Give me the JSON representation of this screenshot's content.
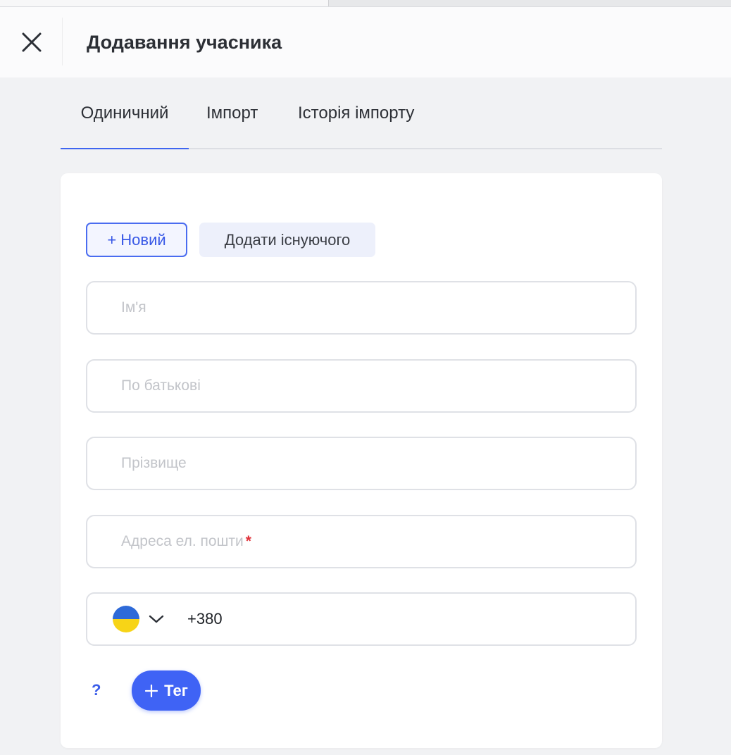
{
  "header": {
    "title": "Додавання учасника",
    "close_icon": "close-icon"
  },
  "tabs": [
    {
      "label": "Одиничний",
      "active": true
    },
    {
      "label": "Імпорт",
      "active": false
    },
    {
      "label": "Історія імпорту",
      "active": false
    }
  ],
  "mode_buttons": {
    "new_label": "+ Новий",
    "existing_label": "Додати існуючого"
  },
  "form": {
    "first_name": {
      "value": "",
      "placeholder": "Ім'я"
    },
    "patronymic": {
      "value": "",
      "placeholder": "По батькові"
    },
    "last_name": {
      "value": "",
      "placeholder": "Прізвище"
    },
    "email": {
      "value": "",
      "placeholder": "Адреса ел. пошти",
      "required_mark": "*"
    },
    "phone": {
      "country_icon": "ukraine-flag-icon",
      "value": "+380"
    }
  },
  "footer": {
    "help_label": "?",
    "tag_label": "Тег"
  },
  "colors": {
    "accent": "#3f63f5",
    "active_tab": "#3f66f0",
    "required": "#e0323a",
    "flag_blue": "#2e6ad8",
    "flag_yellow": "#f7d417"
  }
}
